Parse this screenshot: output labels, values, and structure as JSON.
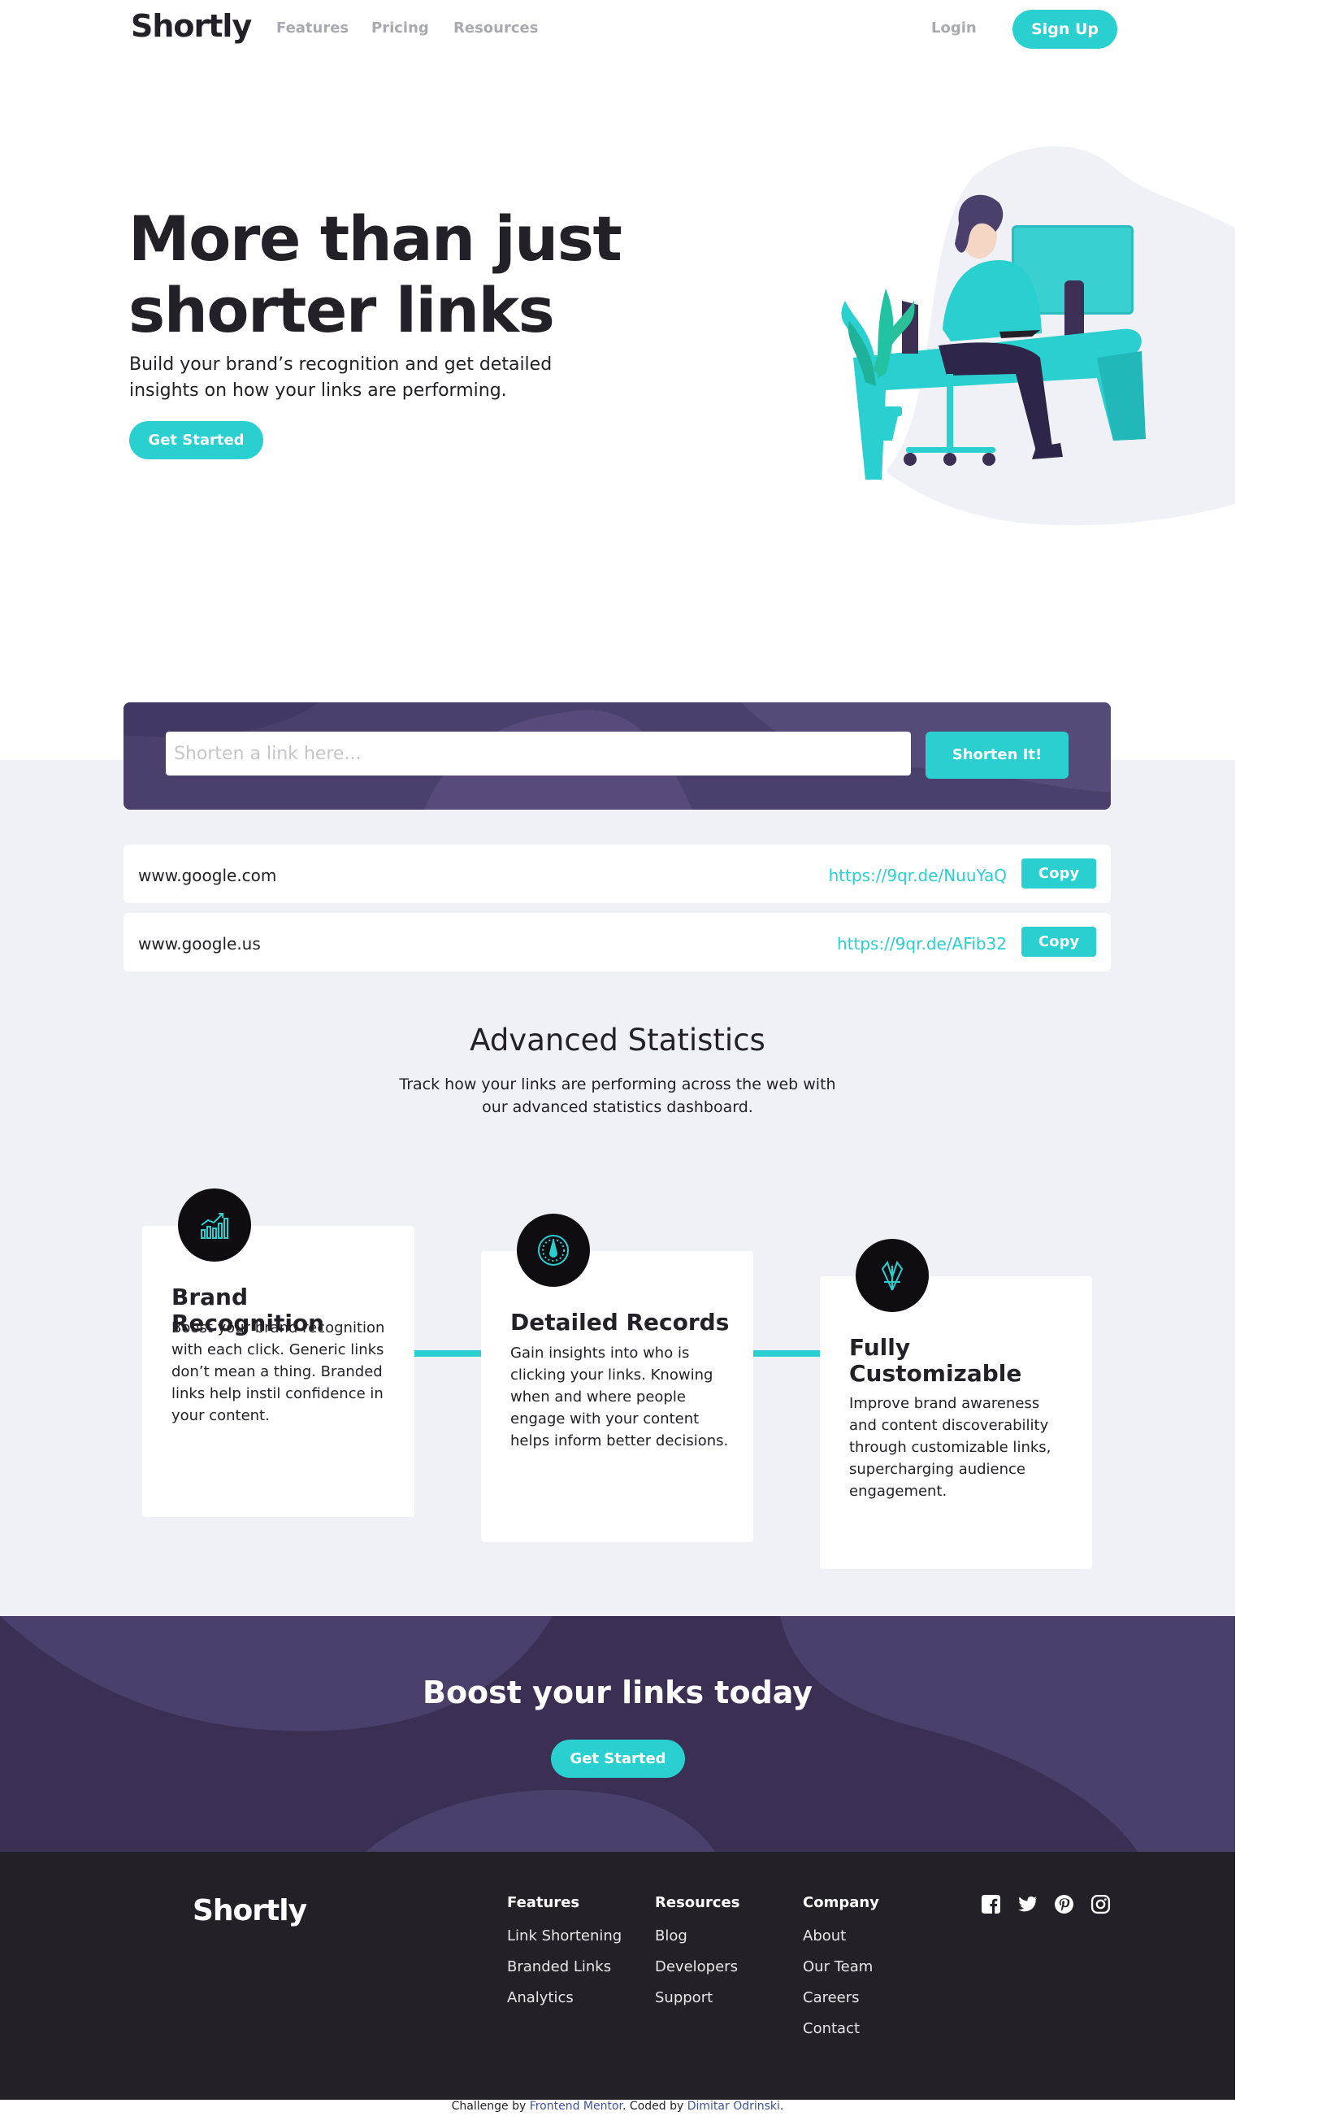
{
  "nav": {
    "logo": "Shortly",
    "links": [
      "Features",
      "Pricing",
      "Resources"
    ],
    "login": "Login",
    "signup": "Sign Up"
  },
  "hero": {
    "title": "More than just shorter links",
    "subtitle": "Build your brand’s recognition and get detailed insights on how your links are performing.",
    "cta": "Get Started"
  },
  "shorten": {
    "placeholder": "Shorten a link here...",
    "button": "Shorten It!"
  },
  "results": [
    {
      "original": "www.google.com",
      "short": "https://9qr.de/NuuYaQ",
      "copy": "Copy"
    },
    {
      "original": "www.google.us",
      "short": "https://9qr.de/AFib32",
      "copy": "Copy"
    }
  ],
  "stats": {
    "title": "Advanced Statistics",
    "subtitle": "Track how your links are performing across the web with our advanced statistics dashboard.",
    "cards": [
      {
        "icon": "brand-recognition-icon",
        "title": "Brand Recognition",
        "text": "Boost your brand recognition with each click. Generic links don’t mean a thing. Branded links help instil confidence in your content."
      },
      {
        "icon": "detailed-records-icon",
        "title": "Detailed Records",
        "text": "Gain insights into who is clicking your links. Knowing when and where people engage with your content helps inform better decisions."
      },
      {
        "icon": "fully-customizable-icon",
        "title": "Fully Customizable",
        "text": "Improve brand awareness and content discoverability through customizable links, supercharging audience engagement."
      }
    ]
  },
  "boost": {
    "title": "Boost your links today",
    "cta": "Get Started"
  },
  "footer": {
    "logo": "Shortly",
    "columns": [
      {
        "heading": "Features",
        "links": [
          "Link Shortening",
          "Branded Links",
          "Analytics"
        ]
      },
      {
        "heading": "Resources",
        "links": [
          "Blog",
          "Developers",
          "Support"
        ]
      },
      {
        "heading": "Company",
        "links": [
          "About",
          "Our Team",
          "Careers",
          "Contact"
        ]
      }
    ],
    "socials": [
      "facebook-icon",
      "twitter-icon",
      "pinterest-icon",
      "instagram-icon"
    ]
  },
  "credit": {
    "prefix": "Challenge by",
    "challenge_link": "Frontend Mentor",
    "middle": ". Coded by",
    "author_link": "Dimitar Odrinski",
    "suffix": "."
  },
  "colors": {
    "cyan": "#2acfcf",
    "dark_violet": "#3b3054",
    "very_dark_violet": "#232127",
    "gray_bg": "#f0f1f6",
    "grayish_violet": "#9e9aa7"
  }
}
